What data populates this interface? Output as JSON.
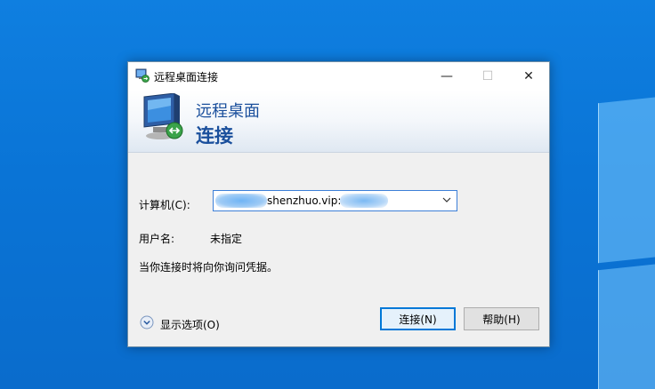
{
  "window": {
    "title": "远程桌面连接",
    "minimize_glyph": "—",
    "maximize_glyph": "☐",
    "close_glyph": "✕"
  },
  "banner": {
    "line1": "远程桌面",
    "line2": "连接"
  },
  "form": {
    "computer_label": "计算机(C):",
    "computer_value": "shenzhuo.vip:",
    "username_label": "用户名:",
    "username_value": "未指定",
    "credentials_note": "当你连接时将向你询问凭据。"
  },
  "footer": {
    "show_options_label": "显示选项(O)",
    "connect_button": "连接(N)",
    "help_button": "帮助(H)"
  },
  "icons": {
    "app": "remote-desktop-icon",
    "options": "chevron-down-circle-icon",
    "dropdown": "chevron-down-icon"
  },
  "colors": {
    "accent": "#0078d7",
    "banner_text": "#1a4f9c",
    "desktop": "#0a74d6"
  }
}
